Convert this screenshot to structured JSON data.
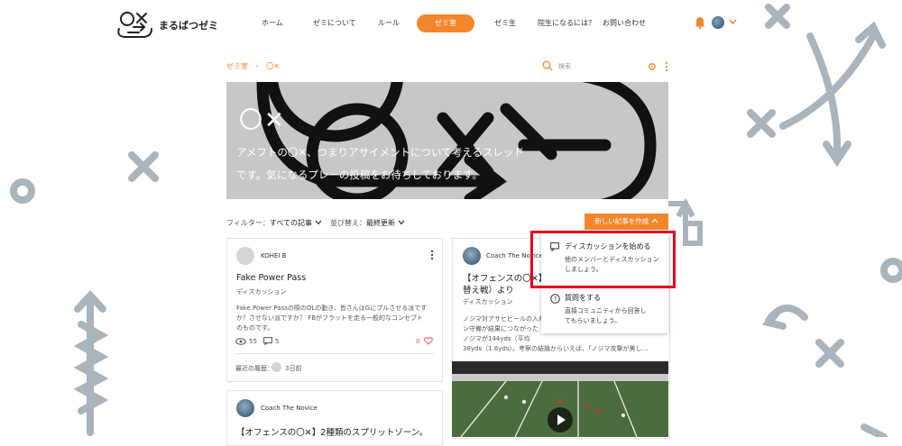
{
  "brand": {
    "name": "まるばつゼミ"
  },
  "nav": {
    "items": [
      "ホーム",
      "ゼミについて",
      "ルール",
      "ゼミ室",
      "ゼミ生",
      "院生になるには？",
      "お問い合わせ"
    ],
    "active_index": 3
  },
  "breadcrumb": [
    "ゼミ室",
    "〇✕"
  ],
  "search": {
    "placeholder": "検索"
  },
  "banner": {
    "title": "〇✕",
    "description_1": "アメフトの〇✕、つまりアサイメントについて考えるスレッド",
    "description_2": "です。気になるプレーの投稿をお待ちしております。"
  },
  "filter": {
    "label": "フィルター：",
    "value": "すべての記事",
    "sort_label": "並び替え：",
    "sort_value": "最終更新"
  },
  "create_button": {
    "label": "新しい記事を作成"
  },
  "dropdown": {
    "start_title": "ディスカッションを始める",
    "start_sub_1": "他のメンバーとディスカッション",
    "start_sub_2": "しましょう。",
    "ask_title": "質問をする",
    "ask_sub_1": "直接コミュニティから回答し",
    "ask_sub_2": "てもらいましょう。"
  },
  "posts": {
    "p1": {
      "author": "KOHEI B",
      "title": "Fake Power Pass",
      "category": "ディスカッション",
      "body_1": "Fake Power Passの際のOLの動き、皆さんはGにプルさせる派です",
      "body_2": "か？させない派ですか？ FBがフラットを走る一般的なコンセプト",
      "body_3": "のものです。",
      "views": "55",
      "comments": "5",
      "likes": "0",
      "recent_label": "最近の履歴：",
      "recent_time": "3日前"
    },
    "p2": {
      "author": "Coach The Novice",
      "title_1": "【オフェンスの〇✕】20",
      "title_2": "替え戦）より",
      "category": "ディスカッション",
      "body_1": "ノジマ対アサヒビールの入れ",
      "body_2": "ン守備が結果につながった",
      "body_3": "ノジマが144yds（平均",
      "body_4": "38yds（1.6yds）。考察の結論からいえば、「ノジマ攻撃が美し…"
    },
    "p3": {
      "author": "Coach The Novice",
      "title": "【オフェンスの〇✕】2種類のスプリットゾーン。"
    }
  },
  "colors": {
    "accent": "#f3862b",
    "highlight": "#e5001c",
    "deco": "#a8b3bb"
  }
}
